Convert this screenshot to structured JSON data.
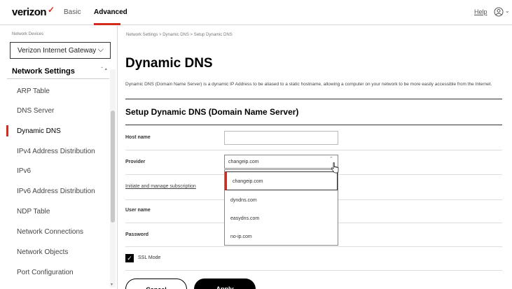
{
  "header": {
    "logo": "verizon",
    "tabs": [
      "Basic",
      "Advanced"
    ],
    "help": "Help",
    "user_chevron": "⌄"
  },
  "sidebar": {
    "device_label": "Network Devices",
    "device_select": "Verizon Internet Gateway",
    "section": "Network Settings",
    "items": [
      "ARP Table",
      "DNS Server",
      "Dynamic DNS",
      "IPv4 Address Distribution",
      "IPv6",
      "IPv6 Address Distribution",
      "NDP Table",
      "Network Connections",
      "Network Objects",
      "Port Configuration"
    ],
    "active_item": "Dynamic DNS"
  },
  "main": {
    "breadcrumb": "Network Settings  >  Dynamic DNS  >  Setup Dynamic DNS",
    "title": "Dynamic DNS",
    "description": "Dynamic DNS (Domain Name Server) is a dynamic IP Address to be aliased to a static hostname, allowing a computer on your network to be more easily accessible from the Internet.",
    "section_title": "Setup Dynamic DNS (Domain Name Server)",
    "fields": {
      "host_name_label": "Host name",
      "host_name_value": "",
      "provider_label": "Provider",
      "provider_value": "changeip.com",
      "subscription_link": "Initiate and manage subscription",
      "user_name_label": "User name",
      "password_label": "Password"
    },
    "provider_options": [
      "changeip.com",
      "dyndns.com",
      "easydns.com",
      "no-ip.com"
    ],
    "ssl_mode_label": "SSL Mode",
    "ssl_mode_checked": true,
    "cancel": "Cancel",
    "apply": "Apply"
  },
  "colors": {
    "accent": "#d52b1e",
    "text": "#000000"
  }
}
